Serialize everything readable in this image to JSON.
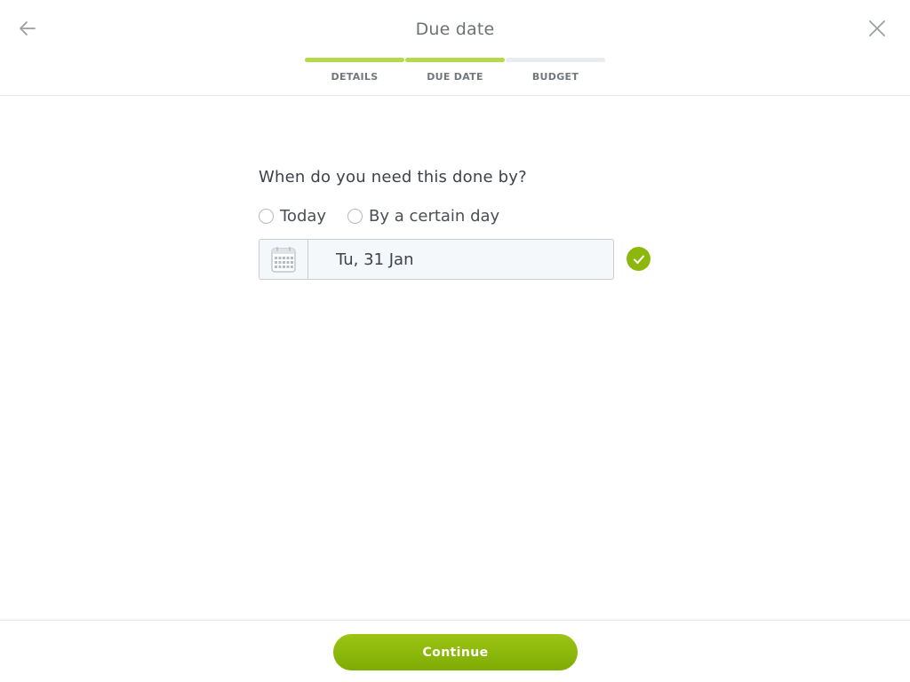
{
  "header": {
    "title": "Due date",
    "back_icon": "arrow-left-icon",
    "close_icon": "close-icon"
  },
  "progress": {
    "steps": [
      {
        "label": "DETAILS",
        "complete": true
      },
      {
        "label": "DUE DATE",
        "complete": true
      },
      {
        "label": "BUDGET",
        "complete": false
      }
    ],
    "complete_color": "#b5d94a",
    "incomplete_color": "#e8ecef"
  },
  "form": {
    "question": "When do you need this done by?",
    "options": [
      {
        "label": "Today",
        "selected": false
      },
      {
        "label": "By a certain day",
        "selected": false
      }
    ],
    "date_field": {
      "value": "Tu, 31 Jan",
      "icon": "calendar-icon"
    },
    "valid_icon": "checkmark-icon",
    "accent_color": "#8cb80e"
  },
  "footer": {
    "continue_label": "Continue"
  }
}
